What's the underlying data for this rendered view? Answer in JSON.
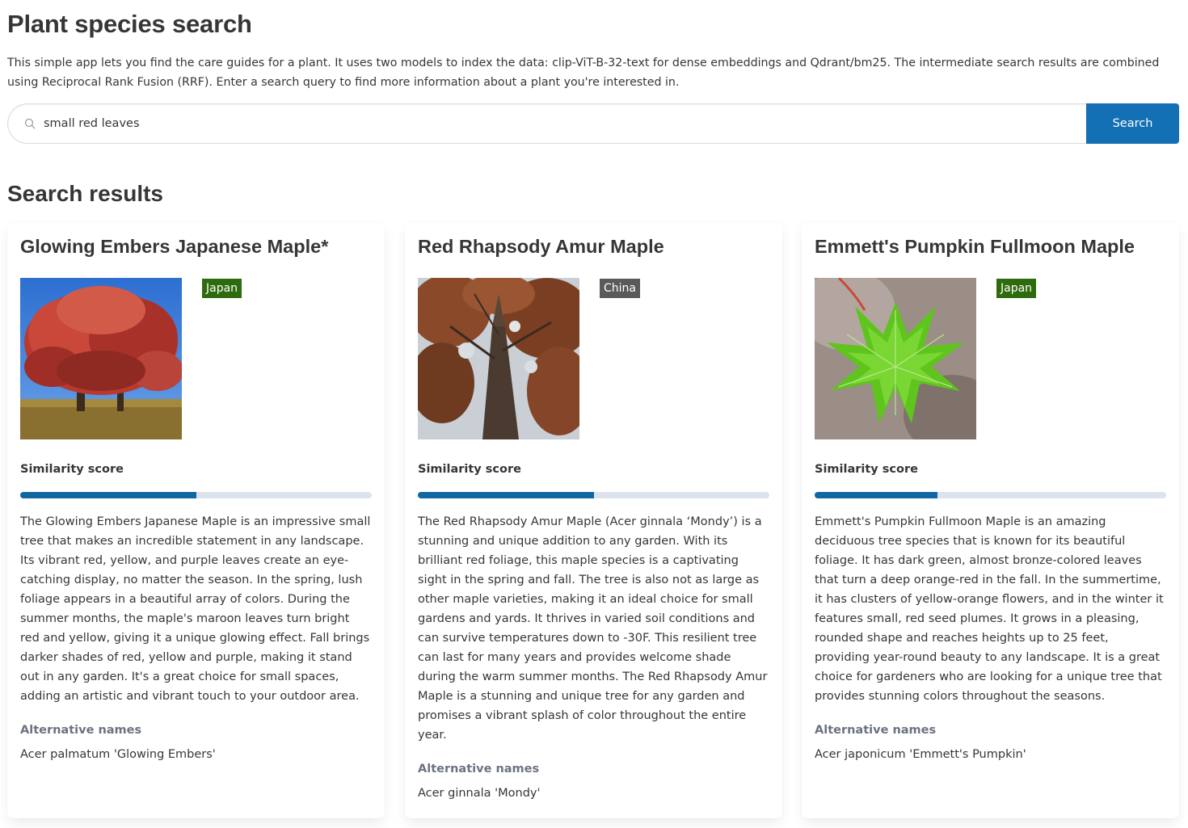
{
  "page": {
    "title": "Plant species search",
    "intro": "This simple app lets you find the care guides for a plant. It uses two models to index the data: clip-ViT-B-32-text for dense embeddings and Qdrant/bm25. The intermediate search results are combined using Reciprocal Rank Fusion (RRF). Enter a search query to find more information about a plant you're interested in."
  },
  "search": {
    "value": "small red leaves",
    "button_label": "Search",
    "icon": "search-icon",
    "button_color": "#1370b5"
  },
  "results": {
    "title": "Search results",
    "similarity_label": "Similarity score",
    "alt_names_label": "Alternative names",
    "items": [
      {
        "name": "Glowing Embers Japanese Maple*",
        "origin": "Japan",
        "origin_color": "#2e6b0f",
        "image": "red-maple-tree-photo",
        "similarity": 0.5,
        "description": "The Glowing Embers Japanese Maple is an impressive small tree that makes an incredible statement in any landscape. Its vibrant red, yellow, and purple leaves create an eye-catching display, no matter the season. In the spring, lush foliage appears in a beautiful array of colors. During the summer months, the maple's maroon leaves turn bright red and yellow, giving it a unique glowing effect. Fall brings darker shades of red, yellow and purple, making it stand out in any garden. It's a great choice for small spaces, adding an artistic and vibrant touch to your outdoor area.",
        "alternative_names": "Acer palmatum 'Glowing Embers'"
      },
      {
        "name": "Red Rhapsody Amur Maple",
        "origin": "China",
        "origin_color": "#5a5a5a",
        "image": "maple-trunk-canopy-photo",
        "similarity": 0.5,
        "description": "The Red Rhapsody Amur Maple (Acer ginnala ‘Mondy’) is a stunning and unique addition to any garden. With its brilliant red foliage, this maple species is a captivating sight in the spring and fall. The tree is also not as large as other maple varieties, making it an ideal choice for small gardens and yards. It thrives in varied soil conditions and can survive temperatures down to -30F. This resilient tree can last for many years and provides welcome shade during the warm summer months. The Red Rhapsody Amur Maple is a stunning and unique tree for any garden and promises a vibrant splash of color throughout the entire year.",
        "alternative_names": "Acer ginnala 'Mondy'"
      },
      {
        "name": "Emmett's Pumpkin Fullmoon Maple",
        "origin": "Japan",
        "origin_color": "#2e6b0f",
        "image": "green-maple-leaf-photo",
        "similarity": 0.35,
        "description": "Emmett's Pumpkin Fullmoon Maple is an amazing deciduous tree species that is known for its beautiful foliage. It has dark green, almost bronze-colored leaves that turn a deep orange-red in the fall. In the summertime, it has clusters of yellow-orange flowers, and in the winter it features small, red seed plumes. It grows in a pleasing, rounded shape and reaches heights up to 25 feet, providing year-round beauty to any landscape. It is a great choice for gardeners who are looking for a unique tree that provides stunning colors throughout the seasons.",
        "alternative_names": "Acer japonicum 'Emmett's Pumpkin'"
      }
    ]
  }
}
